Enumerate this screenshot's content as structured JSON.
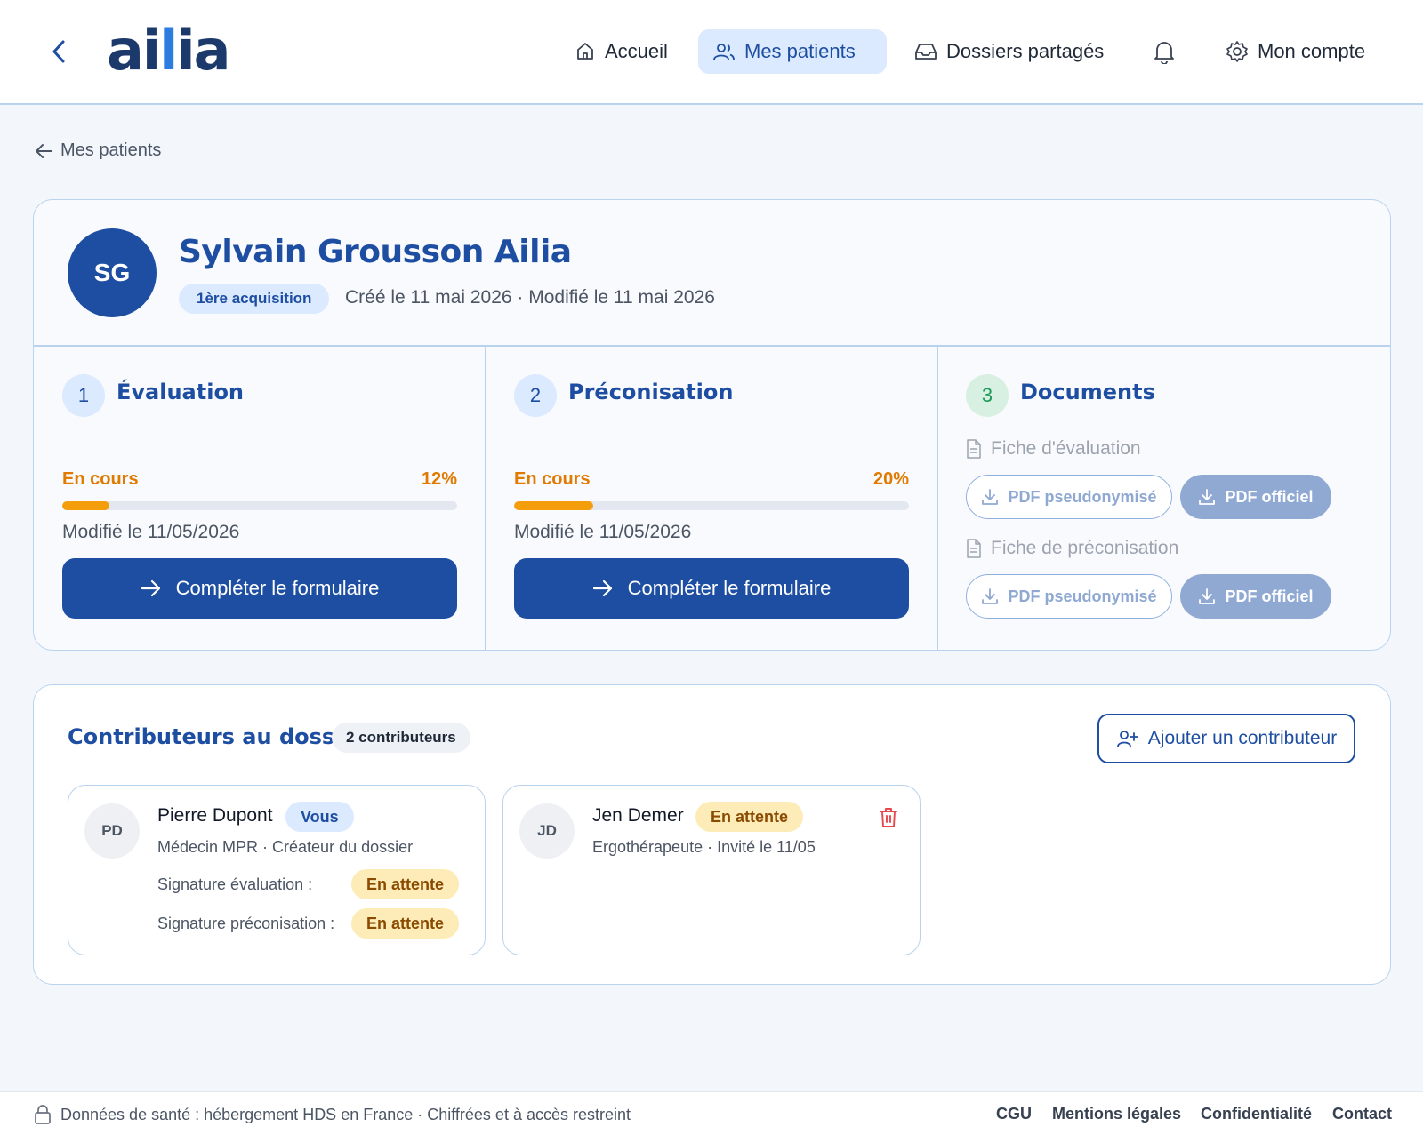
{
  "header": {
    "logo_a": "ai",
    "logo_i": "l",
    "logo_b": "ia",
    "nav": {
      "home": "Accueil",
      "patients": "Mes patients",
      "shared": "Dossiers partagés",
      "account": "Mon compte"
    },
    "active_nav": "Mes patients"
  },
  "breadcrumb": "Mes patients",
  "patient": {
    "initials": "SG",
    "name": "Sylvain Grousson Ailia",
    "badge": "1ère acquisition",
    "dates": "Créé le 11 mai 2026 · Modifié le 11 mai 2026"
  },
  "steps": [
    {
      "number": "1",
      "title": "Évaluation",
      "status": "En cours",
      "percent_label": "12%",
      "progress": 0.12,
      "modified": "Modifié le 11/05/2026",
      "button": "Compléter le formulaire"
    },
    {
      "number": "2",
      "title": "Préconisation",
      "status": "En cours",
      "percent_label": "20%",
      "progress": 0.2,
      "modified": "Modifié le 11/05/2026",
      "button": "Compléter le formulaire"
    },
    {
      "number": "3",
      "title": "Documents",
      "docs": [
        {
          "label": "Fiche d'évaluation",
          "pseudo": "PDF pseudonymisé",
          "official": "PDF officiel"
        },
        {
          "label": "Fiche de préconisation",
          "pseudo": "PDF pseudonymisé",
          "official": "PDF officiel"
        }
      ]
    }
  ],
  "contributors": {
    "title": "Contributeurs au dossier",
    "count": "2 contributeurs",
    "add_button": "Ajouter un contributeur",
    "people": [
      {
        "initials": "PD",
        "name": "Pierre Dupont",
        "tag": "Vous",
        "role": "Médecin MPR · Créateur du dossier",
        "sig_eval_label": "Signature évaluation :",
        "sig_eval_status": "En attente",
        "sig_prec_label": "Signature préconisation :",
        "sig_prec_status": "En attente"
      },
      {
        "initials": "JD",
        "name": "Jen Demer",
        "tag": "En attente",
        "role": "Ergothérapeute · Invité le 11/05"
      }
    ]
  },
  "footer": {
    "notice": "Données de santé : hébergement HDS en France · Chiffrées et à accès restreint",
    "links": [
      "CGU",
      "Mentions légales",
      "Confidentialité",
      "Contact"
    ]
  },
  "colors": {
    "primary": "#1e4ea2",
    "accent_orange": "#e07a00",
    "progress": "#f59e0b",
    "background": "#f3f7fc",
    "border": "#b9d3ee"
  }
}
